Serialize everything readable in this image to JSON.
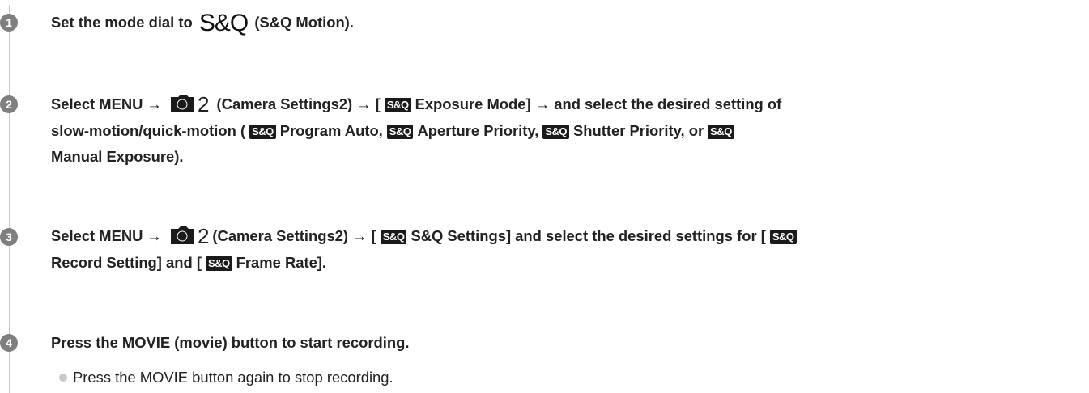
{
  "steps": [
    {
      "number": "1",
      "text_before": "Set the mode dial to",
      "sq_mark": "S&Q",
      "text_after": "(S&Q Motion)."
    },
    {
      "number": "2",
      "line1_a": "Select MENU →",
      "camera_num": "2",
      "line1_b": "(Camera Settings2) → [",
      "badge": "S&Q",
      "line1_c": "Exposure Mode] → and select the desired setting of",
      "line2_a": "slow-motion/quick-motion (",
      "line2_b": "Program Auto,",
      "line2_c": "Aperture Priority,",
      "line2_d": "Shutter Priority, or",
      "line3": "Manual Exposure)."
    },
    {
      "number": "3",
      "line1_a": "Select MENU →",
      "camera_num": "2",
      "line1_b": "(Camera Settings2) → [",
      "line1_c": "S&Q Settings] and select the desired settings for [",
      "line2_a": "Record Setting] and [",
      "line2_b": "Frame Rate]."
    },
    {
      "number": "4",
      "text": "Press the MOVIE (movie) button to start recording.",
      "sub_bullet": "Press the MOVIE button again to stop recording."
    }
  ]
}
